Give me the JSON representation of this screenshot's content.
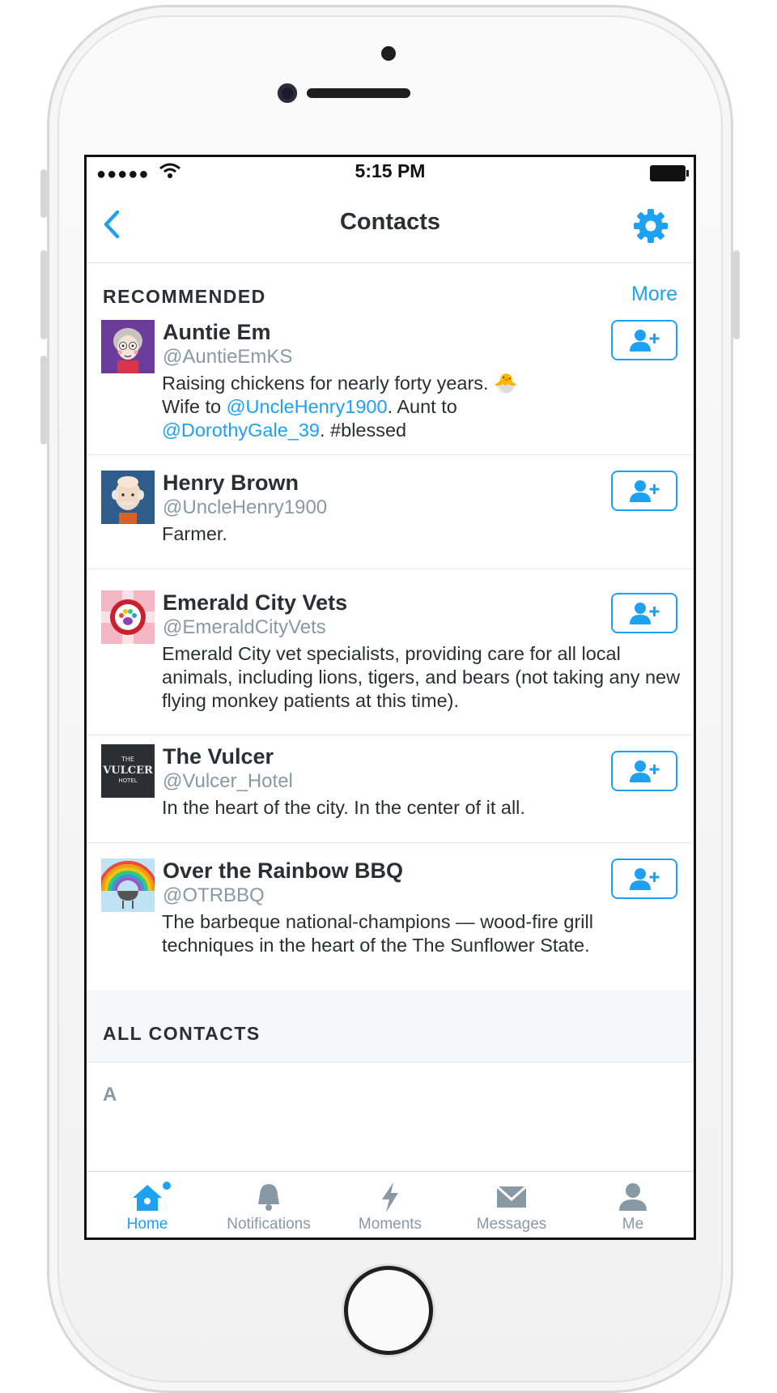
{
  "status_bar": {
    "signal": "●●●●●",
    "time": "5:15 PM"
  },
  "nav": {
    "title": "Contacts"
  },
  "recommended": {
    "label": "RECOMMENDED",
    "more": "More",
    "items": [
      {
        "name": "Auntie Em",
        "handle": "@AuntieEmKS",
        "bio_1": "Raising chickens for nearly forty years. ",
        "bio_emoji": "🐣",
        "bio_2": "Wife to ",
        "bio_link_1": "@UncleHenry1900",
        "bio_3": ". Aunt to",
        "bio_link_2": "@DorothyGale_39",
        "bio_4": ". #blessed"
      },
      {
        "name": "Henry Brown",
        "handle": "@UncleHenry1900",
        "bio": "Farmer."
      },
      {
        "name": "Emerald City Vets",
        "handle": "@EmeraldCityVets",
        "bio": "Emerald City vet specialists, providing care for all local animals, including lions, tigers, and bears (not taking any new flying monkey patients at this time)."
      },
      {
        "name": "The Vulcer",
        "handle": "@Vulcer_Hotel",
        "bio": "In the heart of the city. In the center of it all.",
        "avatar_text_1": "THE",
        "avatar_text_2": "VULCER",
        "avatar_text_3": "HOTEL"
      },
      {
        "name": "Over the Rainbow BBQ",
        "handle": "@OTRBBQ",
        "bio": "The barbeque national-champions — wood-fire grill techniques in the heart of the The Sunflower State."
      }
    ]
  },
  "all_contacts": {
    "label": "ALL CONTACTS",
    "first_letter": "A"
  },
  "tabs": [
    {
      "label": "Home",
      "icon": "home-icon",
      "active": true
    },
    {
      "label": "Notifications",
      "icon": "bell-icon",
      "active": false
    },
    {
      "label": "Moments",
      "icon": "lightning-icon",
      "active": false
    },
    {
      "label": "Messages",
      "icon": "envelope-icon",
      "active": false
    },
    {
      "label": "Me",
      "icon": "person-icon",
      "active": false
    }
  ],
  "colors": {
    "accent": "#1da1f2",
    "text": "#292f33",
    "muted": "#8899a6",
    "section_bg": "#f5f8fa"
  }
}
